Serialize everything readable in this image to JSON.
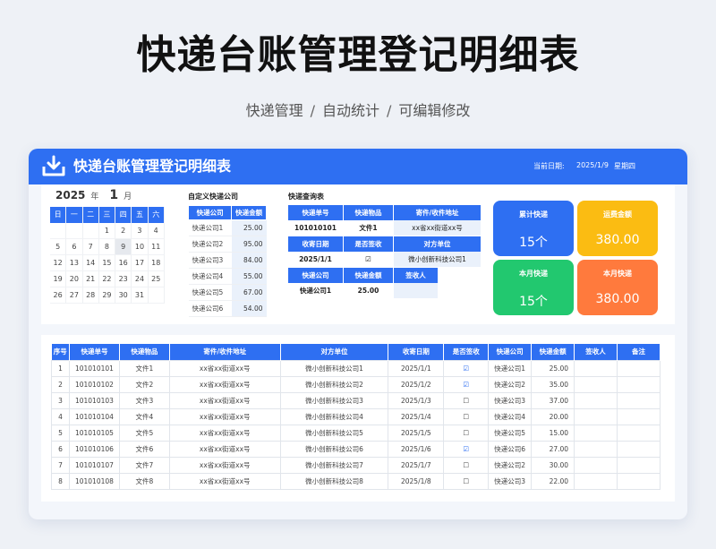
{
  "hero": {
    "title": "快递台账管理登记明细表",
    "sub": [
      "快递管理",
      "自动统计",
      "可编辑修改"
    ],
    "sep": "/"
  },
  "header": {
    "title": "快递台账管理登记明细表",
    "date_label": "当前日期:",
    "date_value": "2025/1/9",
    "weekday": "星期四",
    "icon": "download-icon"
  },
  "calendar": {
    "year": "2025",
    "year_label": "年",
    "month": "1",
    "month_label": "月",
    "weekdays": [
      "日",
      "一",
      "二",
      "三",
      "四",
      "五",
      "六"
    ],
    "weeks": [
      [
        "",
        "",
        "",
        "1",
        "2",
        "3",
        "4"
      ],
      [
        "5",
        "6",
        "7",
        "8",
        "9",
        "10",
        "11"
      ],
      [
        "12",
        "13",
        "14",
        "15",
        "16",
        "17",
        "18"
      ],
      [
        "19",
        "20",
        "21",
        "22",
        "23",
        "24",
        "25"
      ],
      [
        "26",
        "27",
        "28",
        "29",
        "30",
        "31",
        ""
      ]
    ],
    "today": "9"
  },
  "carriers": {
    "title": "自定义快递公司",
    "headers": [
      "快递公司",
      "快递金额"
    ],
    "rows": [
      [
        "快递公司1",
        "25.00"
      ],
      [
        "快递公司2",
        "95.00"
      ],
      [
        "快递公司3",
        "84.00"
      ],
      [
        "快递公司4",
        "55.00"
      ],
      [
        "快递公司5",
        "67.00"
      ],
      [
        "快递公司6",
        "54.00"
      ]
    ]
  },
  "query": {
    "title": "快递查询表",
    "row1_headers": [
      "快递单号",
      "快递物品",
      "寄件/收件地址"
    ],
    "row1_values": [
      "101010101",
      "文件1",
      "xx省xx街道xx号"
    ],
    "row2_headers": [
      "收寄日期",
      "是否签收",
      "对方单位"
    ],
    "row2_values": [
      "2025/1/1",
      "☑",
      "微小创新科技公司1"
    ],
    "row3_headers": [
      "快递公司",
      "快递金额",
      "签收人"
    ],
    "row3_values": [
      "快递公司1",
      "25.00",
      ""
    ]
  },
  "stats": [
    {
      "label": "累计快递",
      "value": "15个",
      "color": "#2e6ff2"
    },
    {
      "label": "运费金额",
      "value": "380.00",
      "color": "#fbbc12"
    },
    {
      "label": "本月快递",
      "value": "15个",
      "color": "#22c86f"
    },
    {
      "label": "本月快递",
      "value": "380.00",
      "color": "#ff7a3d"
    }
  ],
  "table": {
    "headers": [
      "序号",
      "快递单号",
      "快递物品",
      "寄件/收件地址",
      "对方单位",
      "收寄日期",
      "是否签收",
      "快递公司",
      "快递金额",
      "签收人",
      "备注"
    ],
    "rows": [
      [
        "1",
        "101010101",
        "文件1",
        "xx省xx街道xx号",
        "微小创新科技公司1",
        "2025/1/1",
        "☑",
        "快递公司1",
        "25.00",
        "",
        ""
      ],
      [
        "2",
        "101010102",
        "文件2",
        "xx省xx街道xx号",
        "微小创新科技公司2",
        "2025/1/2",
        "☑",
        "快递公司2",
        "35.00",
        "",
        ""
      ],
      [
        "3",
        "101010103",
        "文件3",
        "xx省xx街道xx号",
        "微小创新科技公司3",
        "2025/1/3",
        "☐",
        "快递公司3",
        "37.00",
        "",
        ""
      ],
      [
        "4",
        "101010104",
        "文件4",
        "xx省xx街道xx号",
        "微小创新科技公司4",
        "2025/1/4",
        "☐",
        "快递公司4",
        "20.00",
        "",
        ""
      ],
      [
        "5",
        "101010105",
        "文件5",
        "xx省xx街道xx号",
        "微小创新科技公司5",
        "2025/1/5",
        "☐",
        "快递公司5",
        "15.00",
        "",
        ""
      ],
      [
        "6",
        "101010106",
        "文件6",
        "xx省xx街道xx号",
        "微小创新科技公司6",
        "2025/1/6",
        "☑",
        "快递公司6",
        "27.00",
        "",
        ""
      ],
      [
        "7",
        "101010107",
        "文件7",
        "xx省xx街道xx号",
        "微小创新科技公司7",
        "2025/1/7",
        "☐",
        "快递公司2",
        "30.00",
        "",
        ""
      ],
      [
        "8",
        "101010108",
        "文件8",
        "xx省xx街道xx号",
        "微小创新科技公司8",
        "2025/1/8",
        "☐",
        "快递公司3",
        "22.00",
        "",
        ""
      ]
    ]
  }
}
